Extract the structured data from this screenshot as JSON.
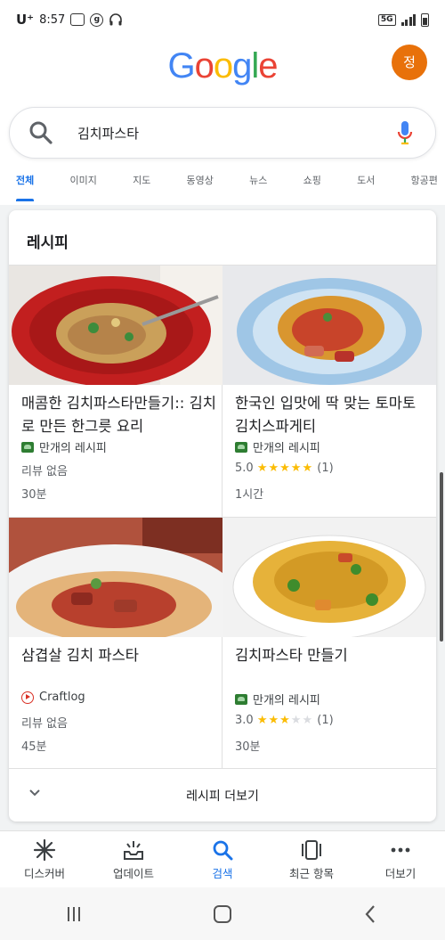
{
  "status": {
    "carrier": "U⁺",
    "time": "8:57",
    "network": "5G"
  },
  "header": {
    "logo": [
      "G",
      "o",
      "o",
      "g",
      "l",
      "e"
    ],
    "logo_colors": [
      "#4285f4",
      "#ea4335",
      "#fbbc05",
      "#4285f4",
      "#34a853",
      "#ea4335"
    ],
    "avatar_initial": "정",
    "avatar_color": "#e8710a"
  },
  "search": {
    "query": "김치파스타"
  },
  "tabs": [
    "전체",
    "이미지",
    "지도",
    "동영상",
    "뉴스",
    "쇼핑",
    "도서",
    "항공편"
  ],
  "recipes": {
    "title": "레시피",
    "items": [
      {
        "title": "매콤한 김치파스타만들기:: 김치로 만든 한그릇 요리",
        "source": "만개의 레시피",
        "source_icon": "recipe-site-icon",
        "review": "리뷰 없음",
        "time": "30분"
      },
      {
        "title": "한국인 입맛에 딱 맞는 토마토 김치스파게티",
        "source": "만개의 레시피",
        "source_icon": "recipe-site-icon",
        "rating": "5.0",
        "stars": 5,
        "count": "(1)",
        "time": "1시간"
      },
      {
        "title": "삼겹살 김치 파스타",
        "source": "Craftlog",
        "source_icon": "play-icon",
        "review": "리뷰 없음",
        "time": "45분"
      },
      {
        "title": "김치파스타 만들기",
        "source": "만개의 레시피",
        "source_icon": "recipe-site-icon",
        "rating": "3.0",
        "stars": 3,
        "count": "(1)",
        "time": "30분"
      }
    ],
    "more_label": "레시피 더보기"
  },
  "bottom_nav": [
    {
      "label": "디스커버",
      "icon": "discover-icon"
    },
    {
      "label": "업데이트",
      "icon": "updates-icon"
    },
    {
      "label": "검색",
      "icon": "search-icon",
      "active": true
    },
    {
      "label": "최근 항목",
      "icon": "recent-icon"
    },
    {
      "label": "더보기",
      "icon": "more-icon"
    }
  ],
  "colors": {
    "accent": "#1a73e8",
    "star": "#fbbc04"
  }
}
